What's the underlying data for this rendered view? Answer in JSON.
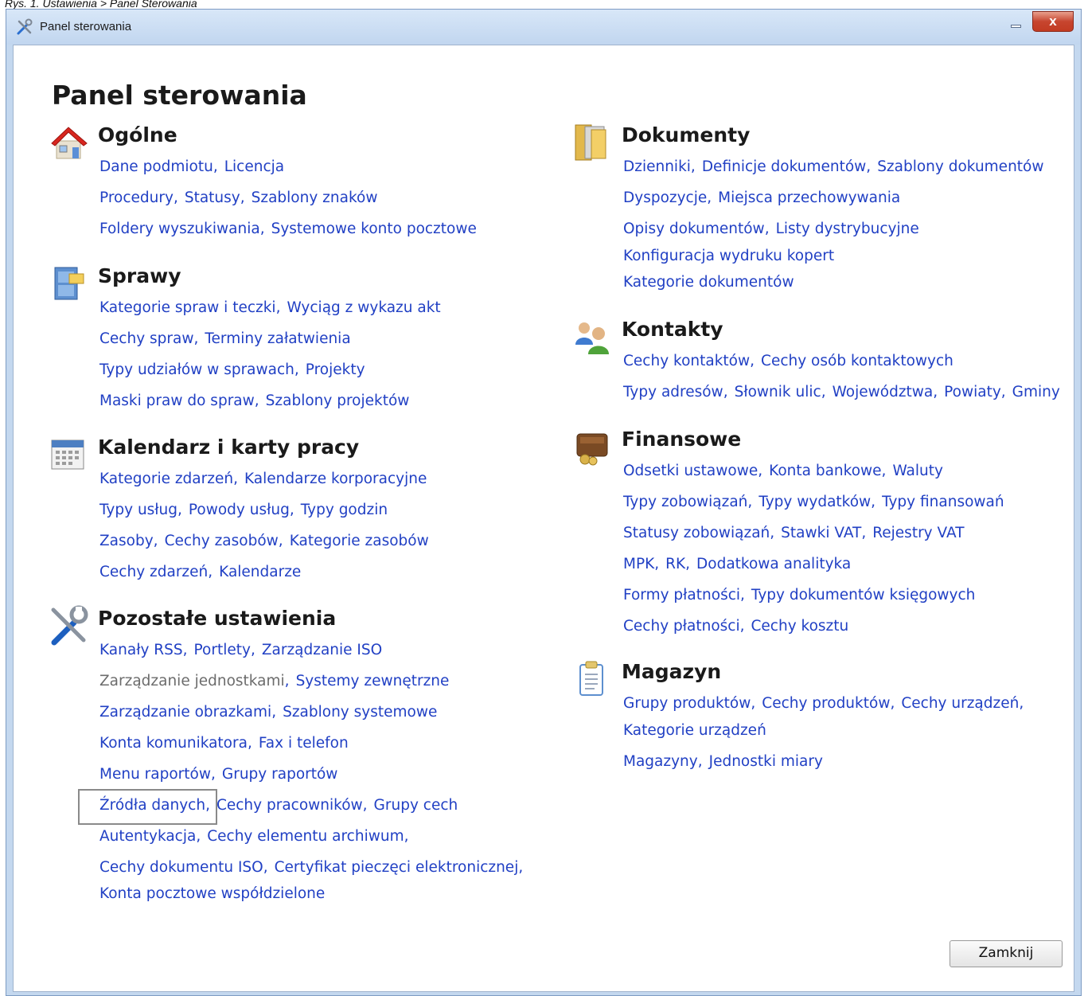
{
  "caption": "Rys. 1. Ustawienia > Panel Sterowania",
  "window": {
    "title": "Panel sterowania",
    "close_glyph": "x"
  },
  "page_title": "Panel sterowania",
  "sections": {
    "ogolne": {
      "title": "Ogólne",
      "icon": "house-icon",
      "lines": [
        [
          "Dane podmiotu",
          "Licencja"
        ],
        [
          "Procedury",
          "Statusy",
          "Szablony znaków"
        ],
        [
          "Foldery wyszukiwania",
          "Systemowe konto pocztowe"
        ]
      ]
    },
    "sprawy": {
      "title": "Sprawy",
      "icon": "filing-cabinet-icon",
      "lines": [
        [
          "Kategorie spraw i teczki",
          "Wyciąg z wykazu akt"
        ],
        [
          "Cechy spraw",
          "Terminy załatwienia"
        ],
        [
          "Typy udziałów w sprawach",
          "Projekty"
        ],
        [
          "Maski praw do spraw",
          "Szablony projektów"
        ]
      ]
    },
    "kalendarz": {
      "title": "Kalendarz i karty pracy",
      "icon": "calendar-icon",
      "lines": [
        [
          "Kategorie zdarzeń",
          "Kalendarze korporacyjne"
        ],
        [
          "Typy usług",
          "Powody usług",
          "Typy godzin"
        ],
        [
          "Zasoby",
          "Cechy zasobów",
          "Kategorie zasobów"
        ],
        [
          "Cechy zdarzeń",
          "Kalendarze"
        ]
      ]
    },
    "pozostale": {
      "title": "Pozostałe ustawienia",
      "icon": "tools-icon",
      "lines": [
        [
          "Kanały RSS",
          "Portlety",
          "Zarządzanie ISO"
        ],
        [
          "Zarządzanie jednostkami",
          "Systemy zewnętrzne"
        ],
        [
          "Zarządzanie obrazkami",
          "Szablony systemowe"
        ],
        [
          "Konta komunikatora",
          "Fax i telefon"
        ],
        [
          "Menu raportów",
          "Grupy raportów"
        ],
        [
          "Źródła danych",
          "Cechy pracowników",
          "Grupy cech"
        ],
        [
          "Autentykacja",
          "Cechy elementu archiwum"
        ],
        [
          "Cechy dokumentu ISO",
          "Certyfikat pieczęci elektronicznej"
        ],
        [
          "Konta pocztowe współdzielone"
        ]
      ]
    },
    "dokumenty": {
      "title": "Dokumenty",
      "icon": "folder-icon",
      "lines": [
        [
          "Dzienniki",
          "Definicje dokumentów",
          "Szablony dokumentów"
        ],
        [
          "Dyspozycje",
          "Miejsca przechowywania"
        ],
        [
          "Opisy dokumentów",
          "Listy dystrybucyjne"
        ],
        [
          "Konfiguracja wydruku kopert"
        ],
        [
          "Kategorie dokumentów"
        ]
      ]
    },
    "kontakty": {
      "title": "Kontakty",
      "icon": "contacts-icon",
      "lines": [
        [
          "Cechy kontaktów",
          "Cechy osób kontaktowych"
        ],
        [
          "Typy adresów",
          "Słownik ulic",
          "Województwa",
          "Powiaty",
          "Gminy"
        ]
      ]
    },
    "finansowe": {
      "title": "Finansowe",
      "icon": "wallet-icon",
      "lines": [
        [
          "Odsetki ustawowe",
          "Konta bankowe",
          "Waluty"
        ],
        [
          "Typy zobowiązań",
          "Typy wydatków",
          "Typy finansowań"
        ],
        [
          "Statusy zobowiązań",
          "Stawki VAT",
          "Rejestry VAT"
        ],
        [
          "MPK",
          "RK",
          "Dodatkowa analityka"
        ],
        [
          "Formy płatności",
          "Typy dokumentów księgowych"
        ],
        [
          "Cechy płatności",
          "Cechy kosztu"
        ]
      ]
    },
    "magazyn": {
      "title": "Magazyn",
      "icon": "clipboard-icon",
      "lines": [
        [
          "Grupy produktów",
          "Cechy produktów",
          "Cechy urządzeń"
        ],
        [
          "Kategorie urządzeń"
        ],
        [
          "Magazyny",
          "Jednostki miary"
        ]
      ]
    }
  },
  "close_button": "Zamknij"
}
